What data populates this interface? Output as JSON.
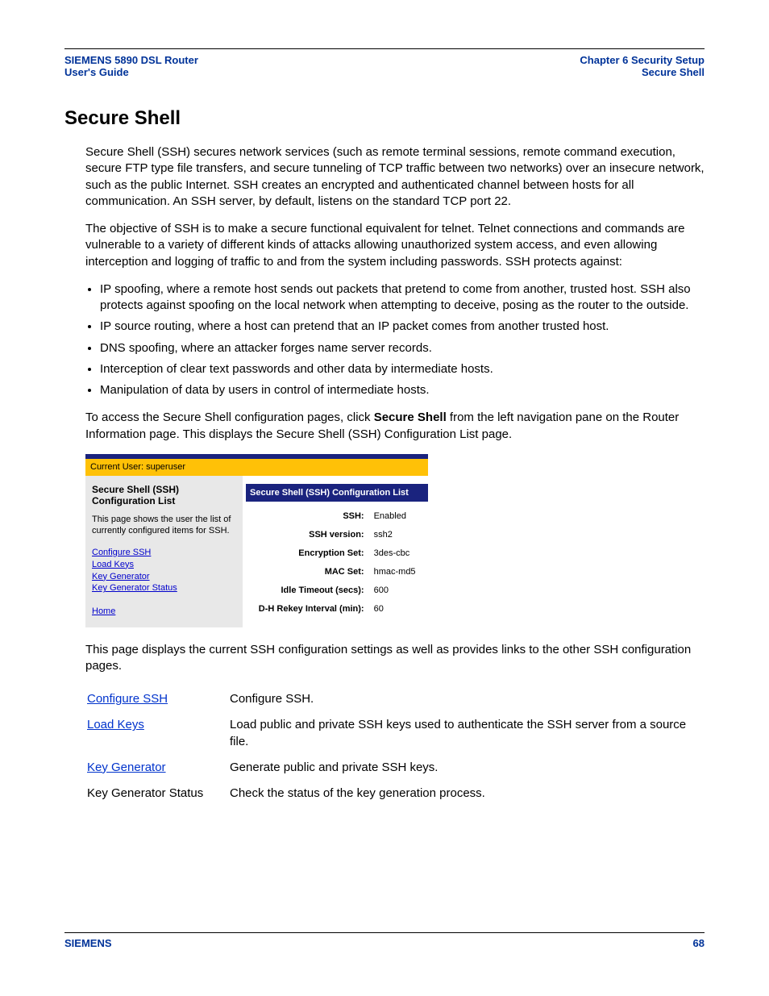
{
  "header": {
    "left_line1": "SIEMENS 5890 DSL Router",
    "left_line2": "User's Guide",
    "right_line1": "Chapter 6  Security Setup",
    "right_line2": "Secure Shell"
  },
  "title": "Secure Shell",
  "para1": "Secure Shell (SSH) secures network services (such as remote terminal sessions, remote command execution, secure FTP type file transfers, and secure tunneling of TCP traffic between two networks) over an insecure network, such as the public Internet. SSH creates an encrypted and authenticated channel between hosts for all communication. An SSH server, by default, listens on the standard TCP port 22.",
  "para2": "The objective of SSH is to make a secure functional equivalent for telnet. Telnet connections and commands are vulnerable to a variety of different kinds of attacks allowing unauthorized system access, and even allowing interception and logging of traffic to and from the system including passwords. SSH protects against:",
  "bullets": [
    "IP spoofing, where a remote host sends out packets that pretend to come from another, trusted host. SSH also protects against spoofing on the local network when attempting to deceive, posing as the router to the outside.",
    "IP source routing, where a host can pretend that an IP packet comes from another trusted host.",
    "DNS spoofing, where an attacker forges name server records.",
    "Interception of clear text passwords and other data by intermediate hosts.",
    "Manipulation of data by users in control of intermediate hosts."
  ],
  "para3_pre": "To access the Secure Shell configuration pages, click ",
  "para3_bold": "Secure Shell",
  "para3_post": " from the left navigation pane on the Router Information page. This displays the Secure Shell (SSH) Configuration List page.",
  "screenshot": {
    "userbar": "Current User: superuser",
    "left_title": "Secure Shell (SSH) Configuration List",
    "left_desc": "This page shows the user the list of currently configured items for SSH.",
    "links": [
      "Configure SSH",
      "Load Keys",
      "Key Generator",
      "Key Generator Status"
    ],
    "home": "Home",
    "panel_title": "Secure Shell (SSH) Configuration List",
    "rows": [
      {
        "label": "SSH:",
        "value": "Enabled"
      },
      {
        "label": "SSH version:",
        "value": "ssh2"
      },
      {
        "label": "Encryption Set:",
        "value": "3des-cbc"
      },
      {
        "label": "MAC Set:",
        "value": "hmac-md5"
      },
      {
        "label": "Idle Timeout (secs):",
        "value": "600"
      },
      {
        "label": "D-H Rekey Interval (min):",
        "value": "60"
      }
    ]
  },
  "para4": "This page displays the current SSH configuration settings as well as provides links to the other SSH configuration pages.",
  "link_table": [
    {
      "label": "Configure SSH",
      "link": true,
      "desc": "Configure SSH."
    },
    {
      "label": "Load Keys",
      "link": true,
      "desc": "Load public and private SSH keys used to authenticate the SSH server from a source file."
    },
    {
      "label": "Key Generator",
      "link": true,
      "desc": "Generate public and private SSH keys."
    },
    {
      "label": "Key Generator Status",
      "link": false,
      "desc": "Check the status of the key generation process."
    }
  ],
  "footer": {
    "left": "SIEMENS",
    "right": "68"
  }
}
